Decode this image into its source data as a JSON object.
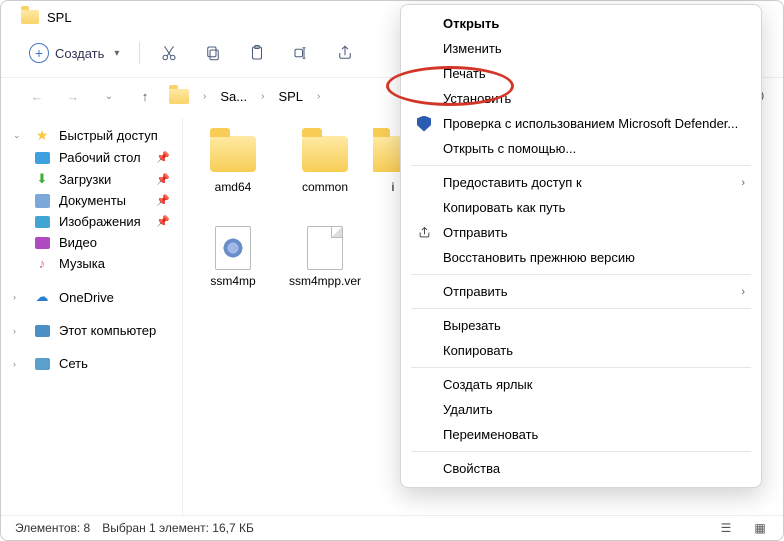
{
  "title": "SPL",
  "toolbar": {
    "new_label": "Создать"
  },
  "breadcrumb": {
    "items": [
      "Sa...",
      "SPL"
    ]
  },
  "sidebar": {
    "quick_access": "Быстрый доступ",
    "desktop": "Рабочий стол",
    "downloads": "Загрузки",
    "documents": "Документы",
    "pictures": "Изображения",
    "video": "Видео",
    "music": "Музыка",
    "onedrive": "OneDrive",
    "this_pc": "Этот компьютер",
    "network": "Сеть"
  },
  "items": [
    {
      "name": "amd64",
      "kind": "folder"
    },
    {
      "name": "common",
      "kind": "folder"
    },
    {
      "name": "i",
      "kind": "folder"
    },
    {
      "name": "ssm4mp",
      "kind": "inf"
    },
    {
      "name": "ssm4mpp.ver",
      "kind": "file"
    }
  ],
  "status": {
    "count": "Элементов: 8",
    "selection": "Выбран 1 элемент: 16,7 КБ"
  },
  "context_menu": {
    "open": "Открыть",
    "change": "Изменить",
    "print": "Печать",
    "install": "Установить",
    "defender": "Проверка с использованием Microsoft Defender...",
    "open_with": "Открыть с помощью...",
    "grant_access": "Предоставить доступ к",
    "copy_path": "Копировать как путь",
    "send_share": "Отправить",
    "restore": "Восстановить прежнюю версию",
    "send_to": "Отправить",
    "cut": "Вырезать",
    "copy": "Копировать",
    "shortcut": "Создать ярлык",
    "delete": "Удалить",
    "rename": "Переименовать",
    "properties": "Свойства"
  }
}
